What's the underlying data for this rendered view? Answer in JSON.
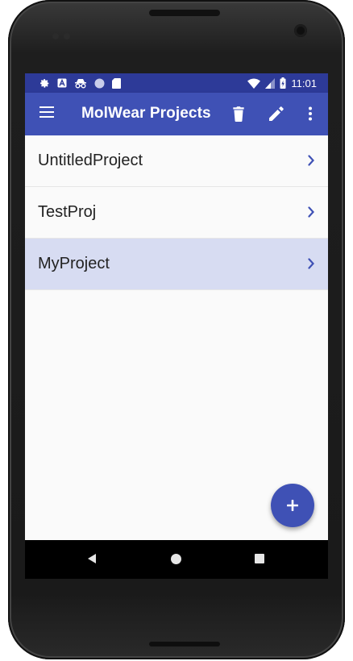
{
  "status_bar": {
    "time": "11:01",
    "icons_left": [
      "settings-icon",
      "a-icon",
      "incognito-icon",
      "circle-icon",
      "sd-card-icon"
    ],
    "icons_right": [
      "wifi-icon",
      "signal-icon",
      "battery-icon"
    ]
  },
  "app_bar": {
    "title": "MolWear Projects",
    "menu_icon": "hamburger-menu-icon",
    "actions": [
      "delete-icon",
      "edit-icon",
      "more-vert-icon"
    ]
  },
  "projects": [
    {
      "name": "UntitledProject",
      "selected": false
    },
    {
      "name": "TestProj",
      "selected": false
    },
    {
      "name": "MyProject",
      "selected": true
    }
  ],
  "fab": {
    "icon": "add-icon",
    "label": "+"
  },
  "nav_bar": {
    "buttons": [
      "back-icon",
      "home-icon",
      "recents-icon"
    ]
  },
  "colors": {
    "primary": "#3f51b5",
    "primary_dark": "#2d3a98",
    "selected_row": "#d7dcf2",
    "background": "#fafafa"
  }
}
